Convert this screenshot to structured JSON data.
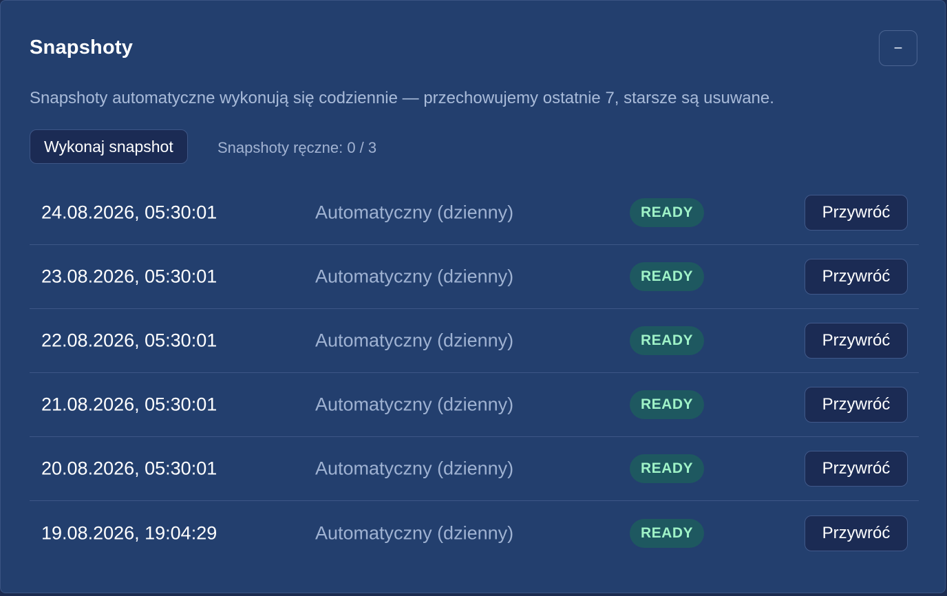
{
  "panel": {
    "title": "Snapshoty",
    "collapse_label": "−",
    "description": "Snapshoty automatyczne wykonują się codziennie — przechowujemy ostatnie 7, starsze są usuwane.",
    "create_button_label": "Wykonaj snapshot",
    "manual_counter": "Snapshoty ręczne: 0 / 3"
  },
  "snapshots": [
    {
      "date": "24.08.2026, 05:30:01",
      "type": "Automatyczny (dzienny)",
      "status": "READY",
      "action": "Przywróć"
    },
    {
      "date": "23.08.2026, 05:30:01",
      "type": "Automatyczny (dzienny)",
      "status": "READY",
      "action": "Przywróć"
    },
    {
      "date": "22.08.2026, 05:30:01",
      "type": "Automatyczny (dzienny)",
      "status": "READY",
      "action": "Przywróć"
    },
    {
      "date": "21.08.2026, 05:30:01",
      "type": "Automatyczny (dzienny)",
      "status": "READY",
      "action": "Przywróć"
    },
    {
      "date": "20.08.2026, 05:30:01",
      "type": "Automatyczny (dzienny)",
      "status": "READY",
      "action": "Przywróć"
    },
    {
      "date": "19.08.2026, 19:04:29",
      "type": "Automatyczny (dzienny)",
      "status": "READY",
      "action": "Przywróć"
    }
  ],
  "colors": {
    "panel_bg": "#233f6e",
    "badge_bg": "#1e5860",
    "badge_text": "#9ff2c7",
    "button_bg": "#1b2b54"
  }
}
